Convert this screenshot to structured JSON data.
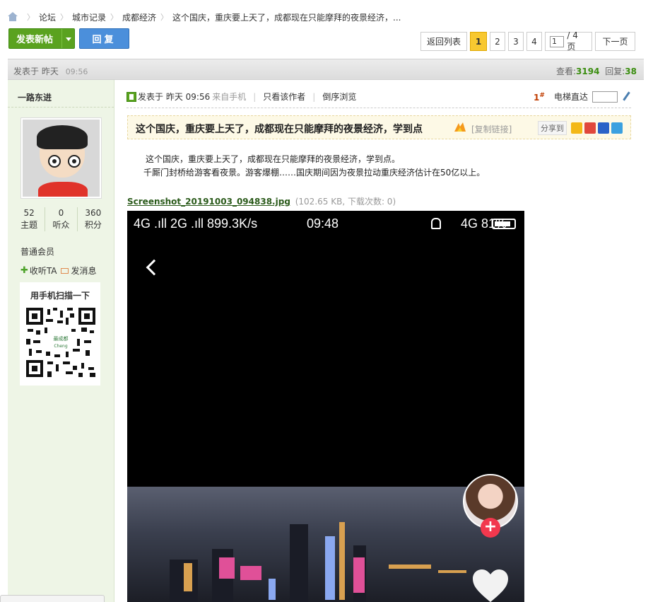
{
  "breadcrumb": {
    "items": [
      "论坛",
      "城市记录",
      "成都经济",
      "这个国庆，重庆要上天了，成都现在只能摩拜的夜景经济，..."
    ]
  },
  "actions": {
    "new_post": "发表新帖",
    "reply": "回复"
  },
  "pager": {
    "back": "返回列表",
    "pages": [
      "1",
      "2",
      "3",
      "4"
    ],
    "current": "1",
    "input_value": "1",
    "total": "/ 4 页",
    "next": "下一页"
  },
  "thread_info": {
    "posted_label": "发表于",
    "posted_day": "昨天",
    "posted_time": "09:56",
    "views_label": "查看:",
    "views": "3194",
    "replies_label": "回复:",
    "replies": "38"
  },
  "author": {
    "name": "一路东进",
    "stats": [
      {
        "value": "52",
        "label": "主题"
      },
      {
        "value": "0",
        "label": "听众"
      },
      {
        "value": "360",
        "label": "积分"
      }
    ],
    "group": "普通会员",
    "follow": "收听TA",
    "message": "发消息",
    "qr_title": "用手机扫描一下",
    "qr_text_1": "最成都",
    "qr_text_2": "Cheng"
  },
  "post": {
    "posted": "发表于 昨天 09:56",
    "via": "来自手机",
    "only_author": "只看该作者",
    "reverse": "倒序浏览",
    "floor": "1",
    "floor_mark": "#",
    "elevator": "电梯直达",
    "title": "这个国庆，重庆要上天了，成都现在只能摩拜的夜景经济，学到点",
    "copy_link": "[复制链接]",
    "share_label": "分享到",
    "body_line1": "这个国庆，重庆要上天了，成都现在只能摩拜的夜景经济，学到点。",
    "body_line2": "千厮门封桥给游客看夜景。游客爆棚……国庆期间因为夜景拉动重庆经济估计在50亿以上。",
    "attachment_name": "Screenshot_20191003_094838.jpg",
    "attachment_meta": "(102.65 KB, 下载次数: 0)"
  },
  "screenshot": {
    "network": "4G .ıll 2G .ıll 899.3K/s",
    "time": "09:48",
    "battery": "4G 81%"
  },
  "colors": {
    "green": "#5aa21f",
    "blue": "#4b8fdb",
    "accent_yellow": "#f8c830",
    "author_bg": "#eef5e6"
  }
}
